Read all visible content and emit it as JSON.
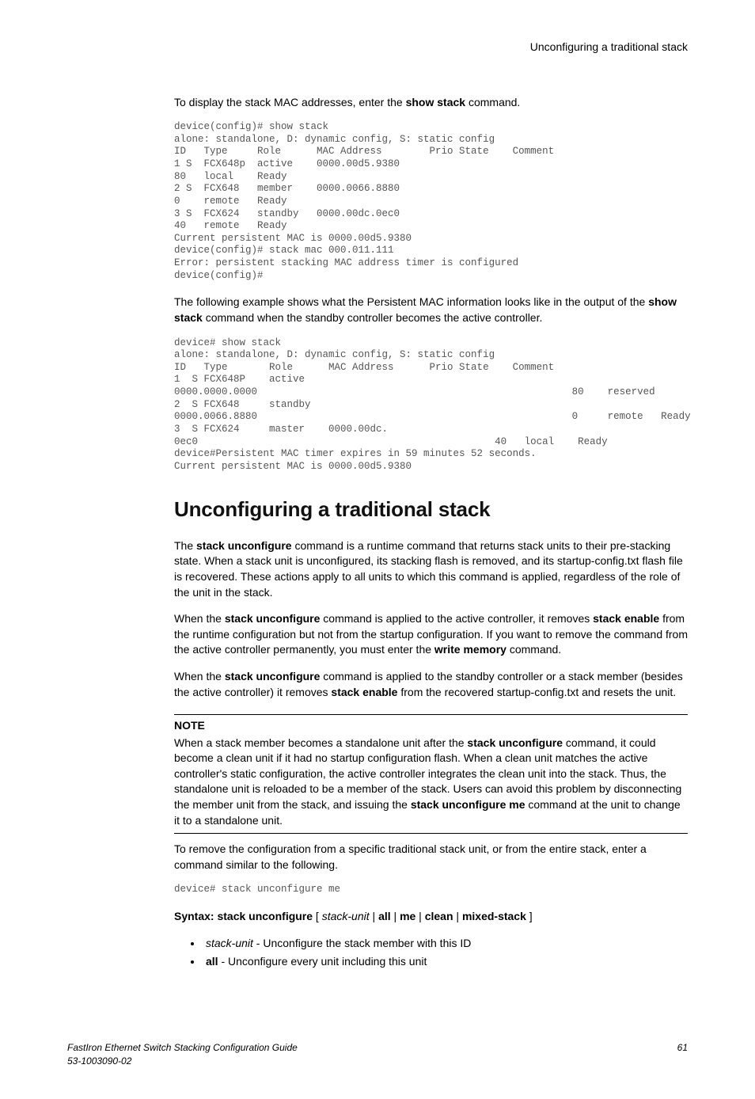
{
  "header": {
    "title": "Unconfiguring a traditional stack"
  },
  "intro": {
    "p1_a": "To display the stack MAC addresses, enter the ",
    "p1_b": "show stack",
    "p1_c": " command."
  },
  "code1": "device(config)# show stack\nalone: standalone, D: dynamic config, S: static config\nID   Type     Role      MAC Address        Prio State    Comment\n1 S  FCX648p  active    0000.00d5.9380\n80   local    Ready\n2 S  FCX648   member    0000.0066.8880\n0    remote   Ready\n3 S  FCX624   standby   0000.00dc.0ec0\n40   remote   Ready\nCurrent persistent MAC is 0000.00d5.9380\ndevice(config)# stack mac 000.011.111\nError: persistent stacking MAC address timer is configured\ndevice(config)#",
  "mid": {
    "p2_a": "The following example shows what the Persistent MAC information looks like in the output of the ",
    "p2_b": "show stack",
    "p2_c": " command when the standby controller becomes the active controller."
  },
  "code2": "device# show stack\nalone: standalone, D: dynamic config, S: static config\nID   Type       Role      MAC Address      Prio State    Comment\n1  S FCX648P    active\n0000.0000.0000                                                     80    reserved\n2  S FCX648     standby\n0000.0066.8880                                                     0     remote   Ready\n3  S FCX624     master    0000.00dc.\n0ec0                                                  40   local    Ready\ndevice#Persistent MAC timer expires in 59 minutes 52 seconds.\nCurrent persistent MAC is 0000.00d5.9380",
  "heading": "Unconfiguring a traditional stack",
  "para3": {
    "a": "The ",
    "b": "stack unconfigure",
    "c": " command is a runtime command that returns stack units to their pre-stacking state. When a stack unit is unconfigured, its stacking flash is removed, and its startup-config.txt flash file is recovered. These actions apply to all units to which this command is applied, regardless of the role of the unit in the stack."
  },
  "para4": {
    "a": "When the ",
    "b": "stack unconfigure",
    "c": " command is applied to the active controller, it removes ",
    "d": "stack enable",
    "e": " from the runtime configuration but not from the startup configuration. If you want to remove the command from the active controller permanently, you must enter the ",
    "f": "write memory",
    "g": " command."
  },
  "para5": {
    "a": "When the ",
    "b": "stack unconfigure",
    "c": " command is applied to the standby controller or a stack member (besides the active controller) it removes ",
    "d": "stack enable",
    "e": " from the recovered startup-config.txt and resets the unit."
  },
  "note": {
    "label": "NOTE",
    "a": "When a stack member becomes a standalone unit after the ",
    "b": "stack unconfigure",
    "c": " command, it could become a clean unit if it had no startup configuration flash. When a clean unit matches the active controller's static configuration, the active controller integrates the clean unit into the stack. Thus, the standalone unit is reloaded to be a member of the stack. Users can avoid this problem by disconnecting the member unit from the stack, and issuing the ",
    "d": "stack unconfigure me",
    "e": " command at the unit to change it to a standalone unit."
  },
  "para6": "To remove the configuration from a specific traditional stack unit, or from the entire stack, enter a command similar to the following.",
  "code3": "device# stack unconfigure me",
  "syntax": {
    "a": "Syntax: stack unconfigure",
    "b": " [ ",
    "c": "stack-unit",
    "d": " | ",
    "e": "all",
    "f": " | ",
    "g": "me",
    "h": " | ",
    "i": "clean",
    "j": " | ",
    "k": "mixed-stack",
    "l": " ]"
  },
  "list": {
    "li1_a": "stack-unit",
    "li1_b": " - Unconfigure the stack member with this ID",
    "li2_a": "all",
    "li2_b": " - Unconfigure every unit including this unit"
  },
  "footer": {
    "left1": "FastIron Ethernet Switch Stacking Configuration Guide",
    "left2": "53-1003090-02",
    "right": "61"
  }
}
